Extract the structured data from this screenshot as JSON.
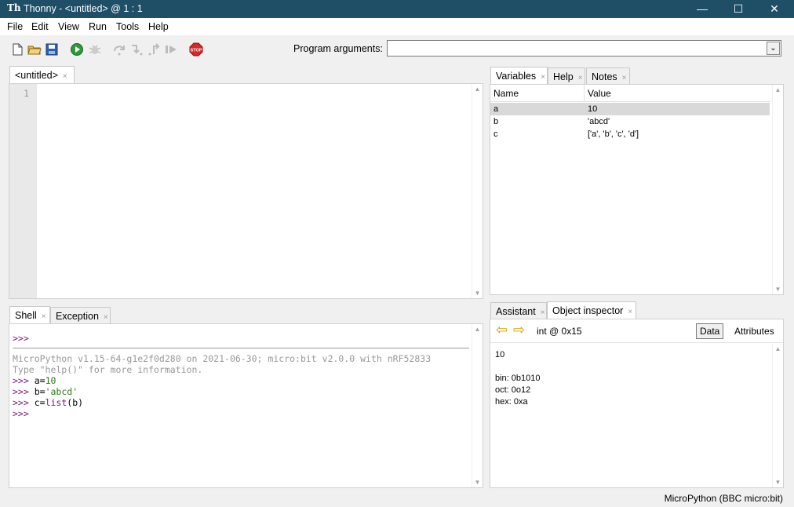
{
  "window": {
    "app_icon_text": "Th",
    "title": "Thonny  -  <untitled>  @  1 : 1",
    "minimize": "—",
    "maximize": "☐",
    "close": "✕"
  },
  "menu": [
    "File",
    "Edit",
    "View",
    "Run",
    "Tools",
    "Help"
  ],
  "toolbar": {
    "icons": [
      "new-file-icon",
      "open-file-icon",
      "save-icon",
      "run-icon",
      "debug-icon",
      "step-over-icon",
      "step-into-icon",
      "step-out-icon",
      "resume-icon",
      "stop-icon"
    ],
    "stop_text": "STOP",
    "program_arguments_label": "Program arguments:",
    "program_arguments_value": "",
    "dropdown_glyph": "⌄"
  },
  "editor": {
    "tab_label": "<untitled>",
    "tab_close": "×",
    "line_numbers": [
      "1"
    ]
  },
  "right_top_tabs": [
    {
      "label": "Variables",
      "close": "×"
    },
    {
      "label": "Help",
      "close": "×"
    },
    {
      "label": "Notes",
      "close": "×"
    }
  ],
  "variables": {
    "headers": [
      "Name",
      "Value"
    ],
    "rows": [
      {
        "name": "a",
        "value": "10"
      },
      {
        "name": "b",
        "value": "'abcd'"
      },
      {
        "name": "c",
        "value": "['a', 'b', 'c', 'd']"
      }
    ]
  },
  "bottom_left_tabs": [
    {
      "label": "Shell",
      "close": "×"
    },
    {
      "label": "Exception",
      "close": "×"
    }
  ],
  "shell": {
    "prompt": ">>>",
    "banner_line1": "MicroPython v1.15-64-g1e2f0d280 on 2021-06-30; micro:bit v2.0.0 with nRF52833",
    "banner_line2": "Type \"help()\" for more information.",
    "cmd1_var": "a=",
    "cmd1_val": "10",
    "cmd2_var": "b=",
    "cmd2_val": "'abcd'",
    "cmd3_var": "c=",
    "cmd3_func": "list",
    "cmd3_rest": "(b)"
  },
  "bottom_right_tabs": [
    {
      "label": "Assistant",
      "close": "×"
    },
    {
      "label": "Object inspector",
      "close": "×"
    }
  ],
  "inspector": {
    "back_glyph": "⇦",
    "forward_glyph": "⇨",
    "object_label": "int @ 0x15",
    "data_button": "Data",
    "attributes_button": "Attributes",
    "value": "10",
    "bin": "bin: 0b1010",
    "oct": "oct: 0o12",
    "hex": "hex: 0xa"
  },
  "status": {
    "interpreter": "MicroPython (BBC micro:bit)"
  }
}
